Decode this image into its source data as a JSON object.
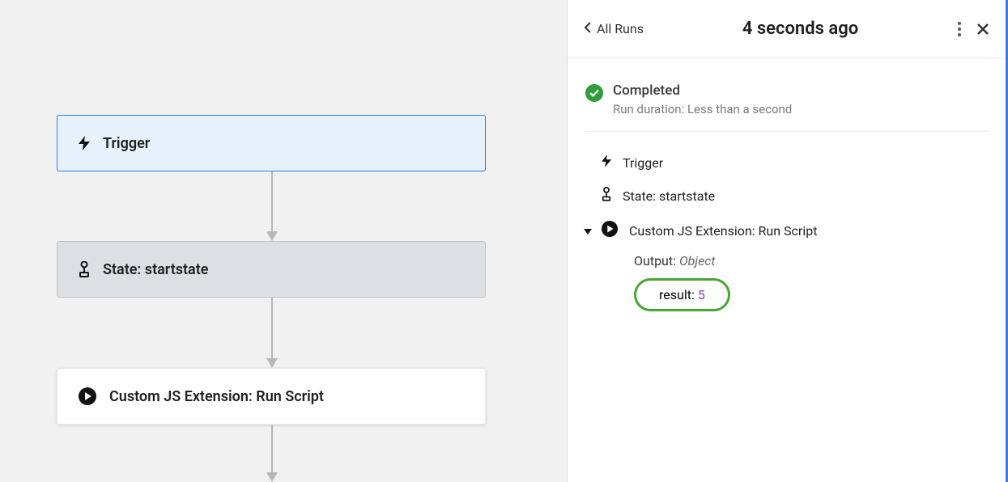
{
  "canvas": {
    "trigger_label": "Trigger",
    "state_label": "State: startstate",
    "action_label": "Custom JS Extension: Run Script"
  },
  "panel": {
    "back_label": "All Runs",
    "title": "4 seconds ago",
    "status": {
      "title": "Completed",
      "subtitle": "Run duration: Less than a second"
    },
    "steps": {
      "trigger": "Trigger",
      "state": "State: startstate",
      "action": "Custom JS Extension: Run Script"
    },
    "output": {
      "label": "Output:",
      "type": "Object",
      "result_key": "result:",
      "result_value": "5"
    }
  }
}
